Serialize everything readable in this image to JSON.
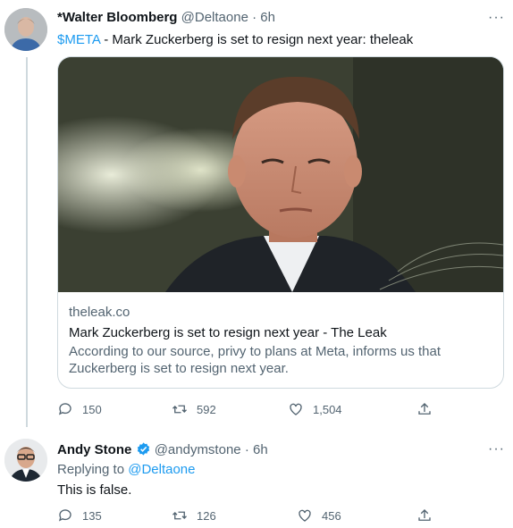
{
  "tweet1": {
    "display_name": "*Walter Bloomberg",
    "handle": "@Deltaone",
    "separator": "·",
    "time": "6h",
    "more": "···",
    "cashtag": "$META",
    "text": " - Mark Zuckerberg is set to resign next year: theleak",
    "card": {
      "domain": "theleak.co",
      "title": "Mark Zuckerberg is set to resign next year - The Leak",
      "description": "According to our source, privy to plans at Meta, informs us that Zuckerberg is set to resign next year."
    },
    "actions": {
      "replies": "150",
      "retweets": "592",
      "likes": "1,504"
    }
  },
  "tweet2": {
    "display_name": "Andy Stone",
    "handle": "@andymstone",
    "separator": "·",
    "time": "6h",
    "more": "···",
    "replying_prefix": "Replying to ",
    "replying_to": "@Deltaone",
    "text": "This is false.",
    "actions": {
      "replies": "135",
      "retweets": "126",
      "likes": "456"
    }
  },
  "colors": {
    "link": "#1d9bf0",
    "muted": "#536471",
    "border": "#cfd9de",
    "verified": "#1d9bf0"
  },
  "icons": [
    "reply-icon",
    "retweet-icon",
    "like-icon",
    "share-icon",
    "verified-icon",
    "more-icon"
  ]
}
